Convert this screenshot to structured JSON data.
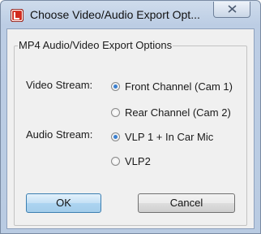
{
  "window": {
    "title": "Choose Video/Audio Export Opt...",
    "close_icon": "close-icon"
  },
  "group": {
    "legend": "MP4 Audio/Video Export Options"
  },
  "video": {
    "label": "Video Stream:",
    "options": [
      {
        "label": "Front Channel (Cam 1)",
        "selected": true
      },
      {
        "label": "Rear Channel (Cam 2)",
        "selected": false
      }
    ]
  },
  "audio": {
    "label": "Audio Stream:",
    "options": [
      {
        "label": "VLP 1 + In Car Mic",
        "selected": true
      },
      {
        "label": "VLP2",
        "selected": false
      }
    ]
  },
  "buttons": {
    "ok": "OK",
    "cancel": "Cancel"
  },
  "colors": {
    "titlebar": "#bccde4",
    "accent": "#3a7fcf",
    "app_icon": "#d12b1f"
  }
}
